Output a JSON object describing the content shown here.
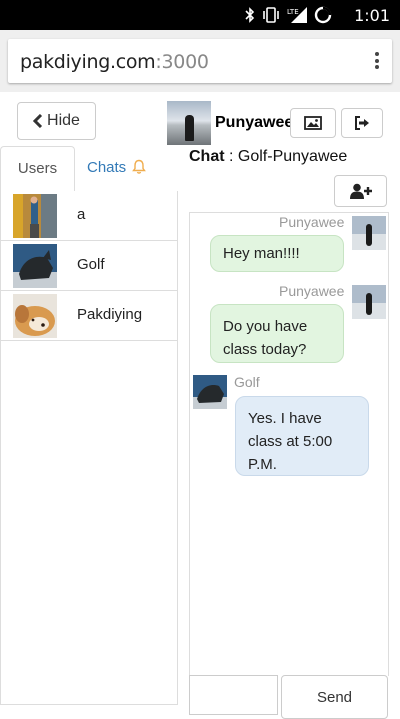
{
  "status_bar": {
    "time": "1:01",
    "icons": [
      "bluetooth-icon",
      "vibrate-icon",
      "lte-signal-icon",
      "battery-icon"
    ]
  },
  "browser": {
    "url_host": "pakdiying.com",
    "url_port": ":3000"
  },
  "header": {
    "hide_label": "Hide",
    "user_name": "Punyawee",
    "chat_prefix": "Chat",
    "chat_name": ": Golf-Punyawee"
  },
  "tabs": {
    "users_label": "Users",
    "chats_label": "Chats"
  },
  "users": [
    {
      "name": "a"
    },
    {
      "name": "Golf"
    },
    {
      "name": "Pakdiying"
    }
  ],
  "messages": [
    {
      "sender": "Punyawee",
      "text": "Hey man!!!!",
      "side": "right"
    },
    {
      "sender": "Punyawee",
      "text": "Do you have class today?",
      "side": "right"
    },
    {
      "sender": "Golf",
      "text": "Yes. I have class at 5:00 P.M.",
      "side": "left"
    }
  ],
  "composer": {
    "send_label": "Send"
  },
  "colors": {
    "link_blue": "#337ab7",
    "bell_orange": "#f0ad4e",
    "my_bubble": "#e2f5e0",
    "their_bubble": "#e1ecf7"
  }
}
